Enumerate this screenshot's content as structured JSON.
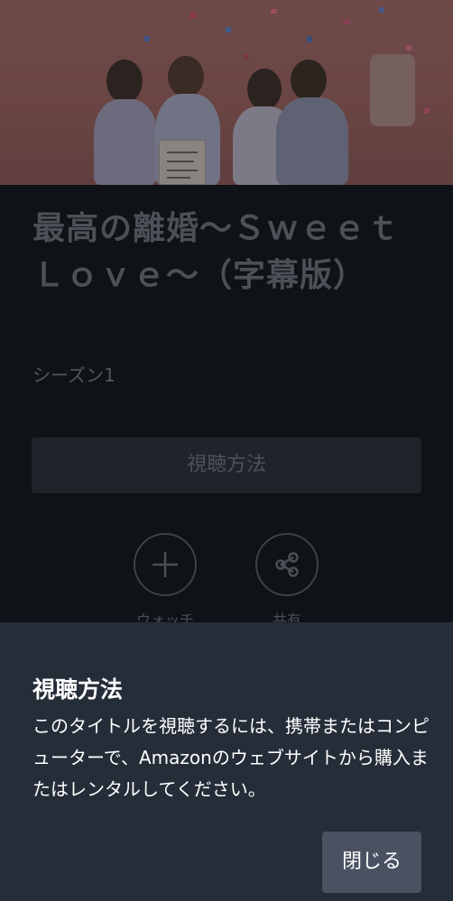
{
  "show": {
    "title": "最高の離婚〜Ｓｗｅｅｔ　Ｌｏｖｅ〜（字幕版）",
    "season": "シーズン1"
  },
  "actions": {
    "how_to_watch_label": "視聴方法",
    "watchlist_label": "ウォッチ",
    "share_label": "共有"
  },
  "dialog": {
    "title": "視聴方法",
    "body": "このタイトルを視聴するには、携帯またはコンピューターで、Amazonのウェブサイトから購入またはレンタルしてください。",
    "close_label": "閉じる"
  },
  "icons": {
    "watchlist": "plus-icon",
    "share": "share-icon"
  },
  "colors": {
    "background": "#0f1216",
    "sheet": "#252d39",
    "close_button": "#4a5262"
  }
}
